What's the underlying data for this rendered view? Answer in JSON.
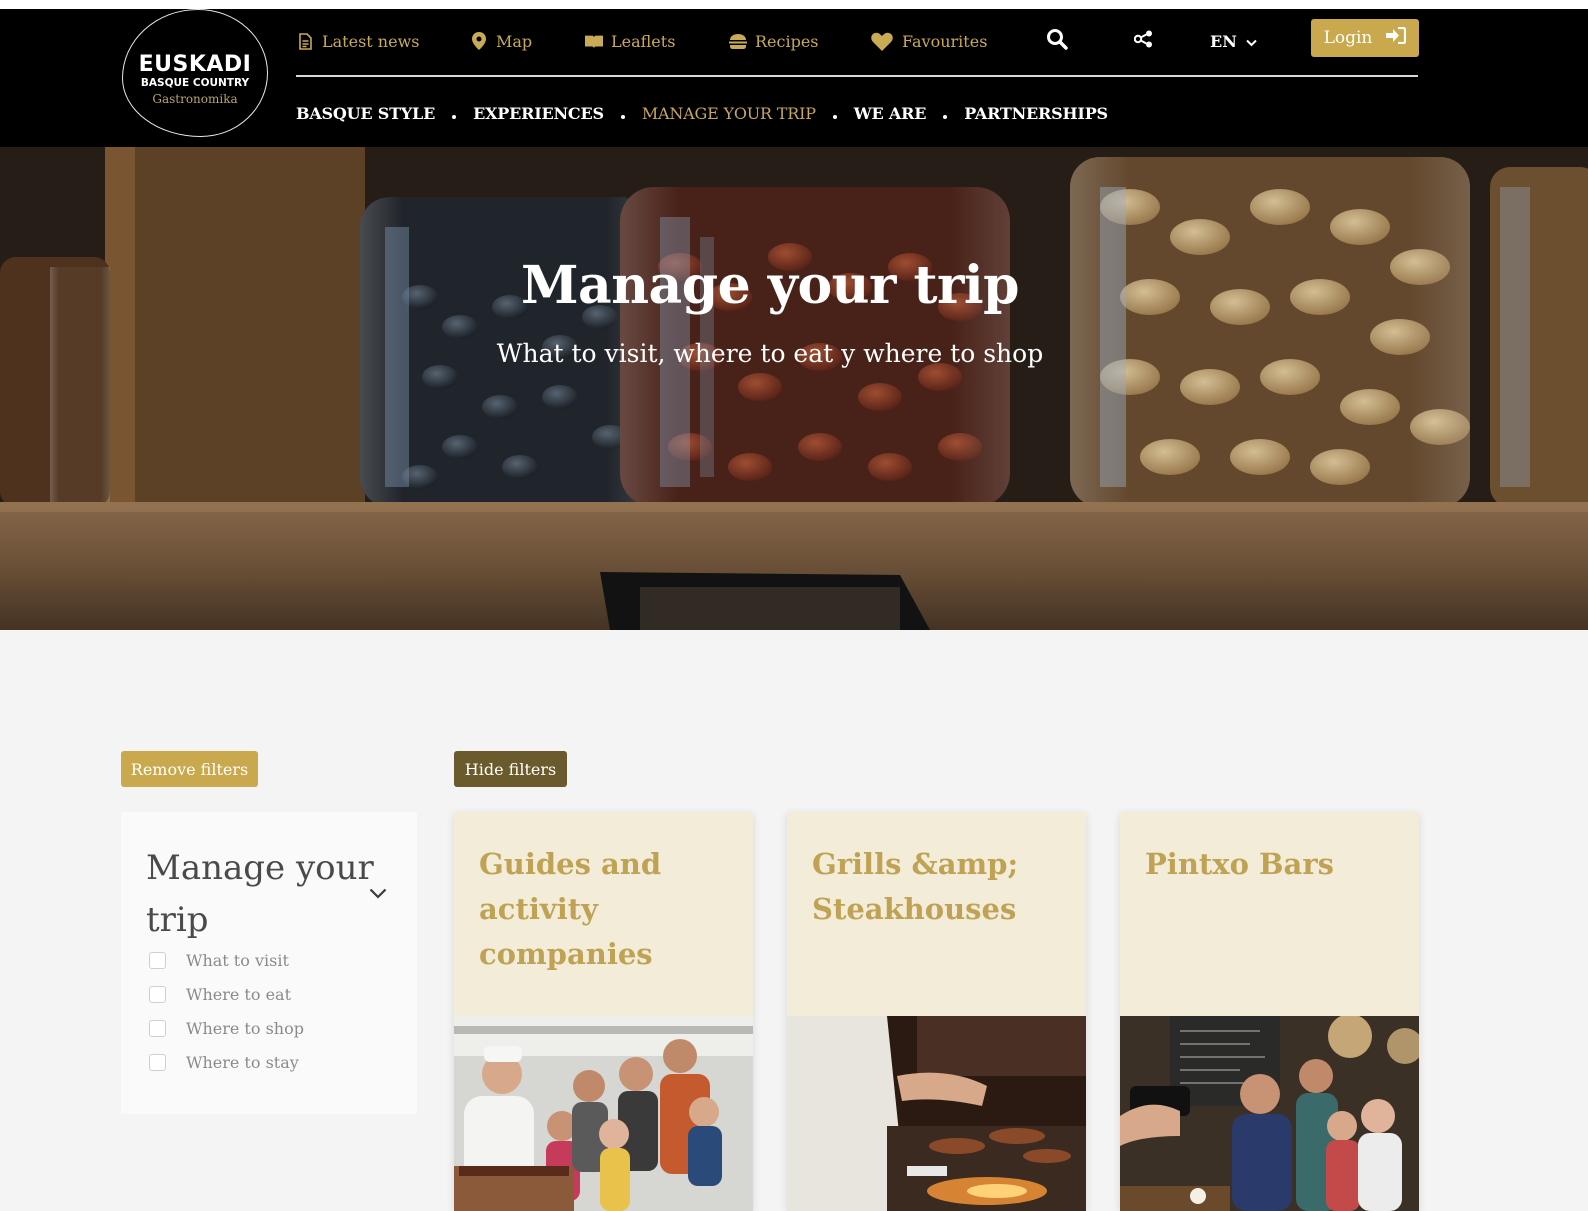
{
  "brand": {
    "line1": "EUSKADI",
    "line2": "BASQUE COUNTRY",
    "line3": "Gastronomika"
  },
  "utility_nav": [
    {
      "label": "Latest news",
      "icon": "document-icon"
    },
    {
      "label": "Map",
      "icon": "map-pin-icon"
    },
    {
      "label": "Leaflets",
      "icon": "open-book-icon"
    },
    {
      "label": "Recipes",
      "icon": "burger-icon"
    },
    {
      "label": "Favourites",
      "icon": "heart-icon"
    }
  ],
  "header_tools": {
    "search_icon": "search-icon",
    "share_icon": "share-icon",
    "language": "EN",
    "login_label": "Login",
    "login_icon": "sign-in-icon"
  },
  "main_nav": [
    {
      "label": "BASQUE STYLE",
      "active": false
    },
    {
      "label": "EXPERIENCES",
      "active": false
    },
    {
      "label": "MANAGE YOUR TRIP",
      "active": true
    },
    {
      "label": "WE ARE",
      "active": false
    },
    {
      "label": "PARTNERSHIPS",
      "active": false
    }
  ],
  "hero": {
    "title": "Manage your trip",
    "subtitle": "What to visit, where to eat y where to shop"
  },
  "filters": {
    "remove_label": "Remove filters",
    "hide_label": "Hide filters",
    "panel_title": "Manage your trip",
    "options": [
      {
        "label": "What to visit",
        "checked": false
      },
      {
        "label": "Where to eat",
        "checked": false
      },
      {
        "label": "Where to shop",
        "checked": false
      },
      {
        "label": "Where to stay",
        "checked": false
      }
    ]
  },
  "cards": [
    {
      "title": "Guides and activity companies"
    },
    {
      "title": "Grills &amp; Steakhouses"
    },
    {
      "title": "Pintxo Bars"
    }
  ],
  "colors": {
    "gold": "#c9a84e",
    "gold_text": "#bfa254",
    "dark_button": "#6b5a2c",
    "card_bg": "#f2ecd9",
    "header_bg": "#000000"
  }
}
